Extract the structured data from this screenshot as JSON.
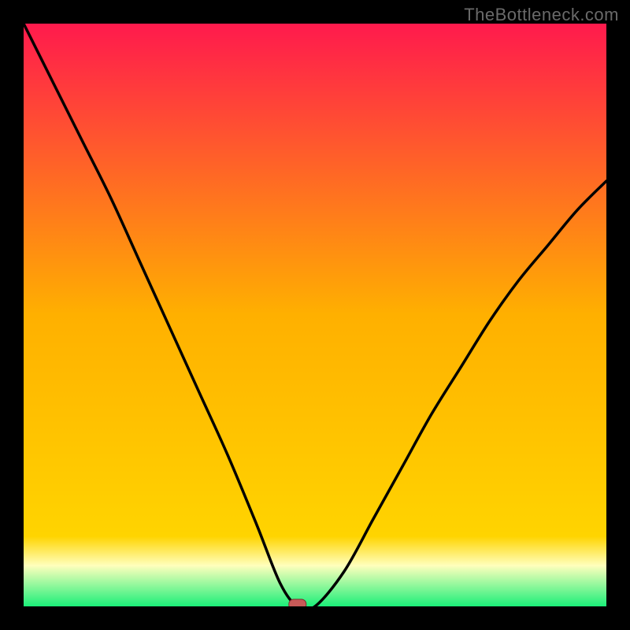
{
  "watermark": "TheBottleneck.com",
  "colors": {
    "frame_bg": "#000000",
    "grad_top": "#ff1a4d",
    "grad_mid": "#ffd400",
    "grad_low": "#ffffbc",
    "grad_bottom": "#1bef79",
    "curve": "#000000",
    "marker_fill": "#c85a58",
    "marker_stroke": "#7a2f2f"
  },
  "chart_data": {
    "type": "line",
    "title": "",
    "xlabel": "",
    "ylabel": "",
    "xlim": [
      0,
      100
    ],
    "ylim": [
      0,
      100
    ],
    "notes": "V-shaped bottleneck curve; minimum (optimal balance) near x≈47. Y represents bottleneck severity (0 = green/good, 100 = red/bad).",
    "series": [
      {
        "name": "bottleneck-curve",
        "x": [
          0,
          5,
          10,
          15,
          20,
          25,
          30,
          35,
          40,
          44,
          47,
          50,
          55,
          60,
          65,
          70,
          75,
          80,
          85,
          90,
          95,
          100
        ],
        "values": [
          100,
          90,
          80,
          70,
          59,
          48,
          37,
          26,
          14,
          4,
          0,
          0,
          6,
          15,
          24,
          33,
          41,
          49,
          56,
          62,
          68,
          73
        ]
      }
    ],
    "marker": {
      "x": 47,
      "y": 0
    },
    "background_gradient_stops": [
      {
        "pos": 0.0,
        "meaning": "worst"
      },
      {
        "pos": 0.5,
        "meaning": "mid"
      },
      {
        "pos": 0.92,
        "meaning": "near-best"
      },
      {
        "pos": 1.0,
        "meaning": "best"
      }
    ]
  }
}
